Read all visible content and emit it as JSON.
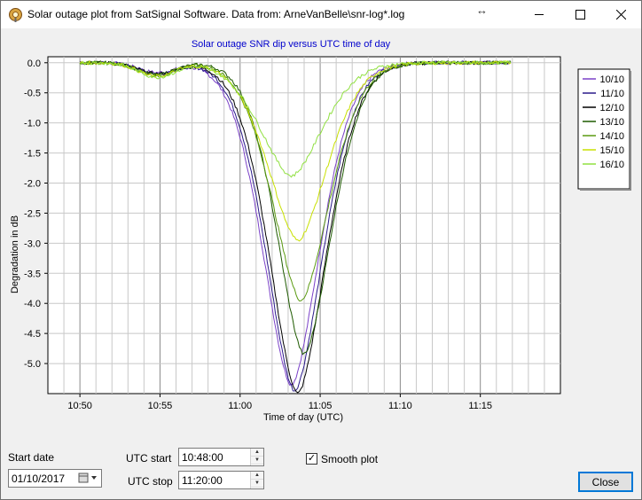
{
  "window": {
    "title": "Solar outage plot from SatSignal Software.  Data from: ArneVanBelle\\snr-log*.log",
    "minimize_label": "—",
    "maximize_label": "☐",
    "close_label": "✕"
  },
  "chart_data": {
    "type": "line",
    "title": "Solar outage SNR dip versus UTC time of day",
    "xlabel": "Time of day (UTC)",
    "ylabel": "Degradation in dB",
    "x_ticks": [
      "10:50",
      "10:55",
      "11:00",
      "11:05",
      "11:10",
      "11:15"
    ],
    "x_tick_minutes": [
      650,
      655,
      660,
      665,
      670,
      675
    ],
    "xlim_minutes": [
      648,
      680
    ],
    "y_ticks": [
      "0.0",
      "-0.5",
      "-1.0",
      "-1.5",
      "-2.0",
      "-2.5",
      "-3.0",
      "-3.5",
      "-4.0",
      "-4.5",
      "-5.0"
    ],
    "ylim": [
      -5.5,
      0.1
    ],
    "grid": true,
    "legend_position": "right",
    "series": [
      {
        "name": "10/10",
        "color": "#7a40c8",
        "center": 663.2,
        "width": 2.3,
        "depth": 5.35
      },
      {
        "name": "11/10",
        "color": "#2a1a8a",
        "center": 663.4,
        "width": 2.3,
        "depth": 5.45
      },
      {
        "name": "12/10",
        "color": "#000000",
        "center": 663.6,
        "width": 2.3,
        "depth": 5.5
      },
      {
        "name": "13/10",
        "color": "#1e5a00",
        "center": 664.0,
        "width": 2.2,
        "depth": 4.85
      },
      {
        "name": "14/10",
        "color": "#5a9a10",
        "center": 663.8,
        "width": 2.3,
        "depth": 3.95
      },
      {
        "name": "15/10",
        "color": "#c8e000",
        "center": 663.6,
        "width": 2.4,
        "depth": 2.95
      },
      {
        "name": "16/10",
        "color": "#90e040",
        "center": 663.2,
        "width": 2.5,
        "depth": 1.88
      }
    ]
  },
  "controls": {
    "start_date_label": "Start date",
    "start_date_value": "01/10/2017",
    "utc_start_label": "UTC start",
    "utc_start_value": "10:48:00",
    "utc_stop_label": "UTC stop",
    "utc_stop_value": "11:20:00",
    "smooth_plot_label": "Smooth plot",
    "smooth_plot_checked": "✓",
    "close_button": "Close"
  }
}
